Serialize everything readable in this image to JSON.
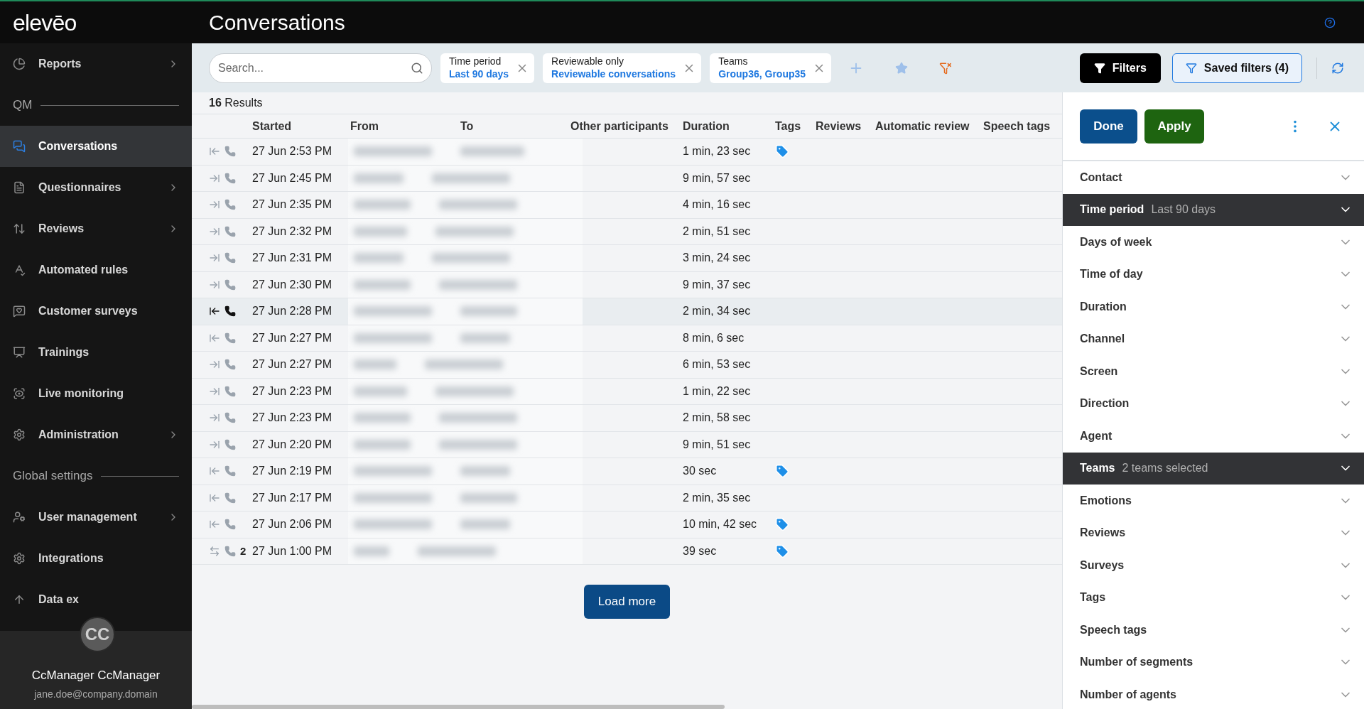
{
  "logo": "elevēo",
  "page_title": "Conversations",
  "sidebar": {
    "items": [
      {
        "kind": "item",
        "label": "Reports",
        "expandable": true,
        "selected": false
      },
      {
        "kind": "section",
        "label": "QM"
      },
      {
        "kind": "item",
        "label": "Conversations",
        "expandable": false,
        "selected": true
      },
      {
        "kind": "item",
        "label": "Questionnaires",
        "expandable": true,
        "selected": false
      },
      {
        "kind": "item",
        "label": "Reviews",
        "expandable": true,
        "selected": false
      },
      {
        "kind": "item",
        "label": "Automated rules",
        "expandable": false,
        "selected": false
      },
      {
        "kind": "item",
        "label": "Customer surveys",
        "expandable": false,
        "selected": false
      },
      {
        "kind": "item",
        "label": "Trainings",
        "expandable": false,
        "selected": false
      },
      {
        "kind": "item",
        "label": "Live monitoring",
        "expandable": false,
        "selected": false
      },
      {
        "kind": "item",
        "label": "Administration",
        "expandable": true,
        "selected": false
      },
      {
        "kind": "section",
        "label": "Global settings"
      },
      {
        "kind": "item",
        "label": "User management",
        "expandable": true,
        "selected": false
      },
      {
        "kind": "item",
        "label": "Integrations",
        "expandable": false,
        "selected": false
      },
      {
        "kind": "item",
        "label": "Data ex",
        "expandable": false,
        "selected": false
      }
    ]
  },
  "user": {
    "initials": "CC",
    "name": "CcManager CcManager",
    "email": "jane.doe@company.domain"
  },
  "search": {
    "placeholder": "Search..."
  },
  "filter_chips": [
    {
      "label": "Time period",
      "value": "Last 90 days"
    },
    {
      "label": "Reviewable only",
      "value": "Reviewable conversations"
    },
    {
      "label": "Teams",
      "value": "Group36, Group35"
    }
  ],
  "filters_button": "Filters",
  "saved_filters_button": "Saved filters (4)",
  "results": {
    "count": "16",
    "label": "Results"
  },
  "table": {
    "columns": [
      "Started",
      "From",
      "To",
      "Other participants",
      "Duration",
      "Tags",
      "Reviews",
      "Automatic review",
      "Speech tags"
    ],
    "rows": [
      {
        "kind": "incoming",
        "started": "27 Jun 2:53 PM",
        "duration": "1 min, 23 sec",
        "tagged": true,
        "selected": false
      },
      {
        "kind": "outgoing",
        "started": "27 Jun 2:45 PM",
        "duration": "9 min, 57 sec",
        "tagged": false,
        "selected": false
      },
      {
        "kind": "outgoing",
        "started": "27 Jun 2:35 PM",
        "duration": "4 min, 16 sec",
        "tagged": false,
        "selected": false
      },
      {
        "kind": "outgoing",
        "started": "27 Jun 2:32 PM",
        "duration": "2 min, 51 sec",
        "tagged": false,
        "selected": false
      },
      {
        "kind": "outgoing",
        "started": "27 Jun 2:31 PM",
        "duration": "3 min, 24 sec",
        "tagged": false,
        "selected": false
      },
      {
        "kind": "outgoing",
        "started": "27 Jun 2:30 PM",
        "duration": "9 min, 37 sec",
        "tagged": false,
        "selected": false
      },
      {
        "kind": "incoming",
        "started": "27 Jun 2:28 PM",
        "duration": "2 min, 34 sec",
        "tagged": false,
        "selected": true
      },
      {
        "kind": "incoming",
        "started": "27 Jun 2:27 PM",
        "duration": "8 min, 6 sec",
        "tagged": false,
        "selected": false
      },
      {
        "kind": "outgoing",
        "started": "27 Jun 2:27 PM",
        "duration": "6 min, 53 sec",
        "tagged": false,
        "selected": false
      },
      {
        "kind": "outgoing",
        "started": "27 Jun 2:23 PM",
        "duration": "1 min, 22 sec",
        "tagged": false,
        "selected": false
      },
      {
        "kind": "outgoing",
        "started": "27 Jun 2:23 PM",
        "duration": "2 min, 58 sec",
        "tagged": false,
        "selected": false
      },
      {
        "kind": "outgoing",
        "started": "27 Jun 2:20 PM",
        "duration": "9 min, 51 sec",
        "tagged": false,
        "selected": false
      },
      {
        "kind": "incoming",
        "started": "27 Jun 2:19 PM",
        "duration": "30 sec",
        "tagged": true,
        "selected": false
      },
      {
        "kind": "incoming",
        "started": "27 Jun 2:17 PM",
        "duration": "2 min, 35 sec",
        "tagged": false,
        "selected": false
      },
      {
        "kind": "incoming",
        "started": "27 Jun 2:06 PM",
        "duration": "10 min, 42 sec",
        "tagged": true,
        "selected": false
      },
      {
        "kind": "internal",
        "segments": "2",
        "started": "27 Jun 1:00 PM",
        "duration": "39 sec",
        "tagged": true,
        "selected": false
      }
    ]
  },
  "load_more": "Load more",
  "filter_panel": {
    "done": "Done",
    "apply": "Apply",
    "items": [
      {
        "label": "Contact",
        "active": false
      },
      {
        "label": "Time period",
        "value": "Last 90 days",
        "active": true
      },
      {
        "label": "Days of week",
        "active": false
      },
      {
        "label": "Time of day",
        "active": false
      },
      {
        "label": "Duration",
        "active": false
      },
      {
        "label": "Channel",
        "active": false
      },
      {
        "label": "Screen",
        "active": false
      },
      {
        "label": "Direction",
        "active": false
      },
      {
        "label": "Agent",
        "active": false
      },
      {
        "label": "Teams",
        "value": "2 teams selected",
        "active": true
      },
      {
        "label": "Emotions",
        "active": false
      },
      {
        "label": "Reviews",
        "active": false
      },
      {
        "label": "Surveys",
        "active": false
      },
      {
        "label": "Tags",
        "active": false
      },
      {
        "label": "Speech tags",
        "active": false
      },
      {
        "label": "Number of segments",
        "active": false
      },
      {
        "label": "Number of agents",
        "active": false
      }
    ]
  }
}
